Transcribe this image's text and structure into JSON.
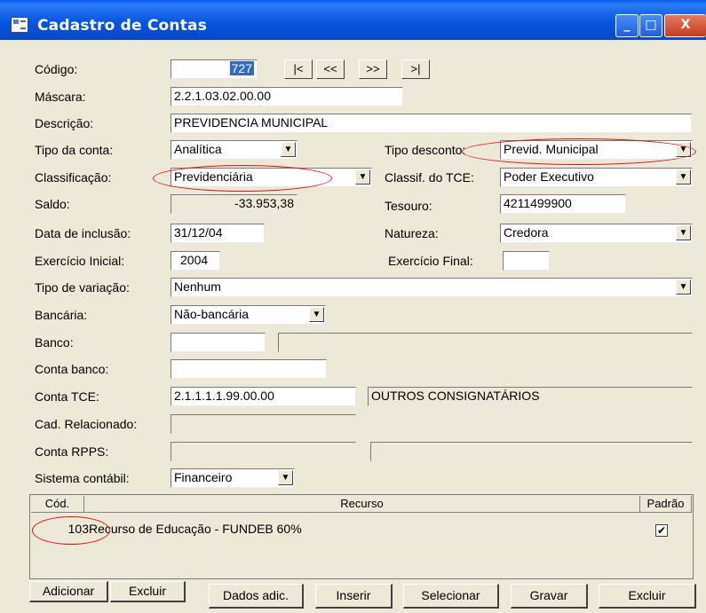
{
  "window": {
    "title": "Cadastro de Contas",
    "min": "_",
    "max": "□",
    "close": "X"
  },
  "codigo": {
    "label": "Código:",
    "value": "727",
    "nav": [
      "|<",
      "<<",
      ">>",
      ">|"
    ]
  },
  "mascara": {
    "label": "Máscara:",
    "value": "2.2.1.03.02.00.00"
  },
  "descricao": {
    "label": "Descrição:",
    "value": "PREVIDENCIA MUNICIPAL"
  },
  "tipo_conta": {
    "label": "Tipo da conta:",
    "value": "Analítica"
  },
  "tipo_desconto": {
    "label": "Tipo desconto:",
    "value": "Previd. Municipal"
  },
  "classificacao": {
    "label": "Classificação:",
    "value": "Previdenciária"
  },
  "classif_tce": {
    "label": "Classif. do TCE:",
    "value": "Poder Executivo"
  },
  "saldo": {
    "label": "Saldo:",
    "value": "-33.953,38"
  },
  "tesouro": {
    "label": "Tesouro:",
    "value": "4211499900"
  },
  "data_inclusao": {
    "label": "Data de inclusão:",
    "value": "31/12/04"
  },
  "natureza": {
    "label": "Natureza:",
    "value": "Credora"
  },
  "exercicio_inicial": {
    "label": "Exercício Inicial:",
    "value": "2004"
  },
  "exercicio_final": {
    "label": "Exercício Final:",
    "value": ""
  },
  "tipo_variacao": {
    "label": "Tipo de variação:",
    "value": "Nenhum"
  },
  "bancaria": {
    "label": "Bancária:",
    "value": "Não-bancária"
  },
  "banco": {
    "label": "Banco:",
    "value": "",
    "desc": ""
  },
  "conta_banco": {
    "label": "Conta banco:",
    "value": ""
  },
  "conta_tce": {
    "label": "Conta TCE:",
    "value": "2.1.1.1.1.99.00.00",
    "desc": "OUTROS CONSIGNATÁRIOS"
  },
  "cad_relacionado": {
    "label": "Cad. Relacionado:",
    "value": ""
  },
  "conta_rpps": {
    "label": "Conta RPPS:",
    "value": "",
    "desc": ""
  },
  "sistema_contabil": {
    "label": "Sistema contábil:",
    "value": "Financeiro"
  },
  "grid": {
    "headers": {
      "cod": "Cód.",
      "recurso": "Recurso",
      "padrao": "Padrão"
    },
    "rows": [
      {
        "cod": "103",
        "recurso": "Recurso de Educação - FUNDEB 60%",
        "padrao": "✔"
      }
    ]
  },
  "buttons": {
    "adicionar": "Adicionar",
    "excluir_small": "Excluir",
    "dados_adic": "Dados adic.",
    "inserir": "Inserir",
    "selecionar": "Selecionar",
    "gravar": "Gravar",
    "excluir": "Excluir"
  },
  "icons": {
    "dropdown": "dropdown-arrow-icon",
    "app": "window-app-icon"
  },
  "colors": {
    "titlebar": "#0756e0",
    "selection": "#316ac5",
    "annotation": "#e01010",
    "face": "#ece9d8"
  }
}
